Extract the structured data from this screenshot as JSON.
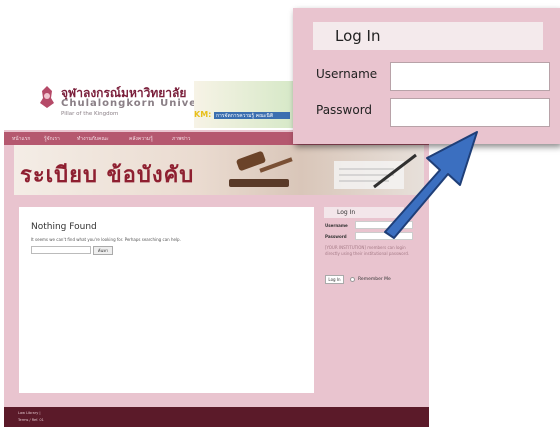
{
  "header": {
    "university_th": "จุฬาลงกรณ์มหาวิทยาลัย",
    "university_en": "Chulalongkorn University",
    "tagline": "Pillar of the Kingdom",
    "km_label": "KM:",
    "km_sub": "การจัดการความรู้ คณะนิติ"
  },
  "nav": {
    "items": [
      "หน้าแรก",
      "รู้จักเรา",
      "ทำงานกับคณะ",
      "คลังความรู้",
      "ภาพข่าว"
    ]
  },
  "hero": {
    "title": "ระเบียบ ข้อบังคับ"
  },
  "content": {
    "title": "Nothing Found",
    "text": "It seems we can't find what you're looking for. Perhaps searching can help.",
    "search_button": "ค้นหา"
  },
  "sidebar_login": {
    "title": "Log In",
    "username_label": "Username",
    "password_label": "Password",
    "note": "[YOUR INSTITUTION] members can login directly using their institutional password.",
    "login_button": "Log In",
    "remember_label": "Remember Me"
  },
  "footer": {
    "line1": "Law Library |",
    "line2": "Terms / Ref. 01"
  },
  "zoom_login": {
    "title": "Log In",
    "username_label": "Username",
    "password_label": "Password"
  },
  "colors": {
    "page_pink": "#e9c4cf",
    "nav_bar": "#b5586f",
    "footer": "#5b1a29",
    "arrow_blue": "#3b6fc0",
    "hero_title": "#8e1f30"
  }
}
